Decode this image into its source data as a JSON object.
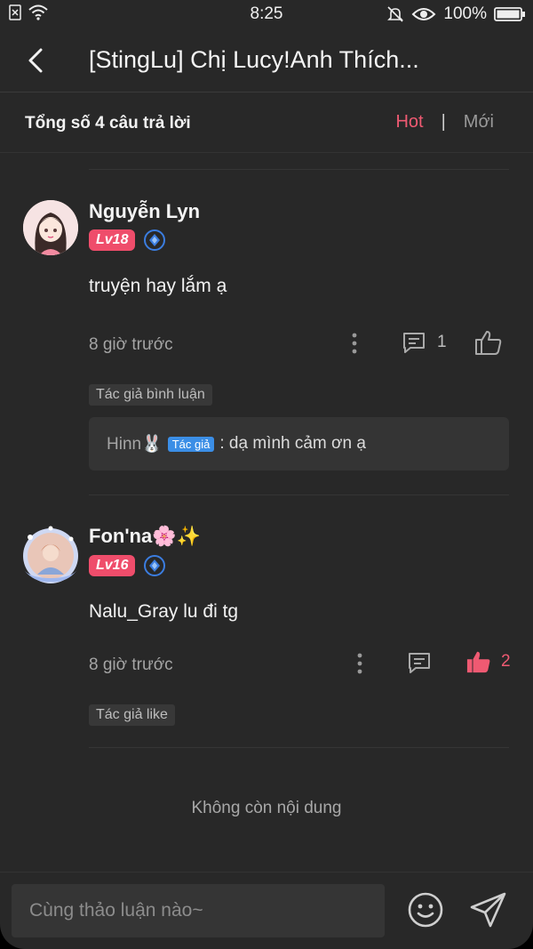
{
  "status": {
    "time": "8:25",
    "battery": "100%"
  },
  "header": {
    "title": "[StingLu] Chị Lucy!Anh Thích..."
  },
  "summary": {
    "count_label": "Tổng số 4 câu trả lời",
    "sort_hot": "Hot",
    "sort_sep": "|",
    "sort_new": "Mới"
  },
  "comments": [
    {
      "name": "Nguyễn Lyn",
      "level": "Lv18",
      "text": "truyện hay lắm ạ",
      "time": "8 giờ trước",
      "reply_count": "1",
      "like_count": "",
      "tag": "Tác giả bình luận",
      "reply": {
        "user": "Hinn🐰",
        "author_badge": "Tác giả",
        "text": " : dạ mình cảm ơn ạ"
      }
    },
    {
      "name": "Fon'na🌸✨",
      "level": "Lv16",
      "text": "Nalu_Gray lu đi tg",
      "time": "8 giờ trước",
      "reply_count": "",
      "like_count": "2",
      "tag": "Tác giả like"
    }
  ],
  "footer_note": "Không còn nội dung",
  "input": {
    "placeholder": "Cùng thảo luận nào~"
  },
  "colors": {
    "accent": "#ef5a72",
    "level_badge": "#ef4d6b",
    "author_badge": "#3b8ee6",
    "background": "#282828"
  }
}
